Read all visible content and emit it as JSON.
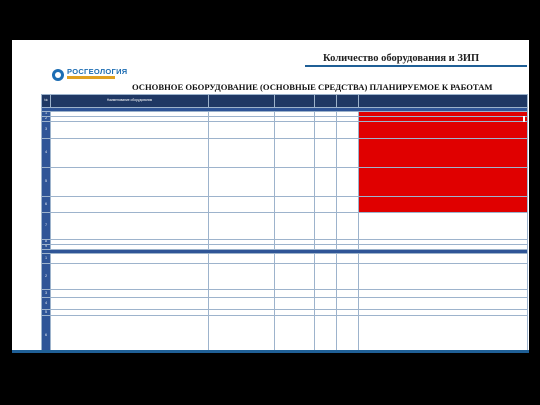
{
  "header": {
    "title": "Количество оборудования и ЗИП"
  },
  "logo": {
    "text": "РОСГЕОЛОГИЯ"
  },
  "main_title": "ОСНОВНОЕ ОБОРУДОВАНИЕ (ОСНОВНЫЕ СРЕДСТВА) ПЛАНИРУЕМОЕ К РАБОТАМ",
  "table": {
    "columns": [
      "№",
      "Наименование оборудования",
      "",
      "",
      "",
      "",
      ""
    ],
    "sections": [
      "",
      ""
    ],
    "rows_a": [
      {
        "n": "1",
        "name": "",
        "inv": "",
        "q1": "",
        "q2": "",
        "q3": "",
        "note": ""
      },
      {
        "n": "2",
        "name": "",
        "inv": "",
        "q1": "",
        "q2": "",
        "q3": "",
        "note": ""
      },
      {
        "n": "3",
        "name": "",
        "inv": "",
        "q1": "",
        "q2": "",
        "q3": "",
        "note": ""
      },
      {
        "n": "4",
        "name": "",
        "inv": "",
        "q1": "",
        "q2": "",
        "q3": "",
        "note": ""
      },
      {
        "n": "5",
        "name": "",
        "inv": "",
        "q1": "",
        "q2": "",
        "q3": "",
        "note": ""
      },
      {
        "n": "6",
        "name": "",
        "inv": "",
        "q1": "",
        "q2": "",
        "q3": "",
        "note": ""
      },
      {
        "n": "7",
        "name": "",
        "inv": "",
        "q1": "",
        "q2": "",
        "q3": "",
        "note": ""
      },
      {
        "n": "8",
        "name": "",
        "inv": "",
        "q1": "",
        "q2": "",
        "q3": "",
        "note": ""
      },
      {
        "n": "9",
        "name": "",
        "inv": "",
        "q1": "",
        "q2": "",
        "q3": "",
        "note": ""
      }
    ],
    "rows_b": [
      {
        "n": "1",
        "name": "",
        "inv": "",
        "q1": "",
        "q2": "",
        "q3": "",
        "note": ""
      },
      {
        "n": "2",
        "name": "",
        "inv": "",
        "q1": "",
        "q2": "",
        "q3": "",
        "note": ""
      },
      {
        "n": "3",
        "name": "",
        "inv": "",
        "q1": "",
        "q2": "",
        "q3": "",
        "note": ""
      },
      {
        "n": "4",
        "name": "",
        "inv": "",
        "q1": "",
        "q2": "",
        "q3": "",
        "note": ""
      },
      {
        "n": "5",
        "name": "",
        "inv": "",
        "q1": "",
        "q2": "",
        "q3": "",
        "note": ""
      },
      {
        "n": "6",
        "name": "",
        "inv": "",
        "q1": "",
        "q2": "",
        "q3": "",
        "note": ""
      }
    ]
  },
  "footer": {
    "url": ""
  },
  "colors": {
    "accent": "#1f5f96",
    "header_row": "#1f3864",
    "section_row": "#2f5597",
    "flag": "#e00000"
  }
}
